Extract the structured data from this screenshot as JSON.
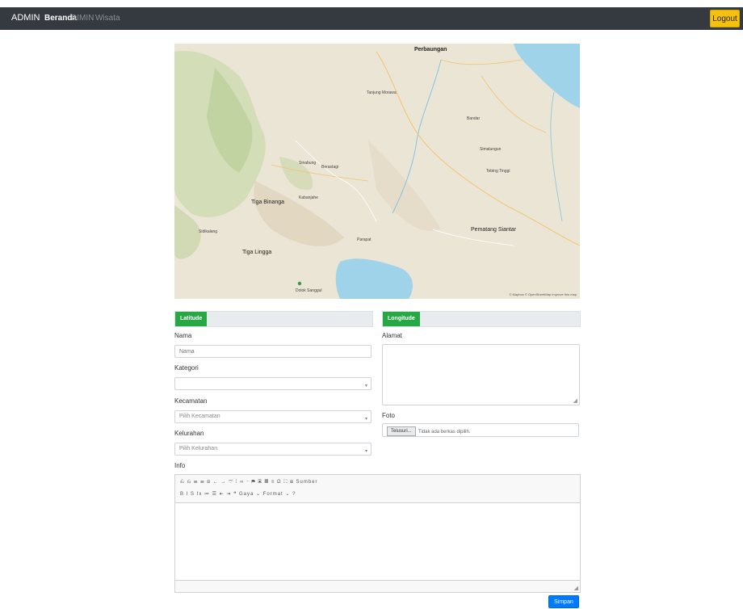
{
  "navbar": {
    "brand": "ADMIN",
    "links": [
      "Beranda",
      "DIMIN",
      "Wisata"
    ],
    "logout_label": "Logout"
  },
  "map": {
    "places": {
      "perbaungan": "Perbaungan",
      "pematang_siantar": "Pematang Siantar",
      "tiga_binanga": "Tiga Binanga",
      "tiga_lingga": "Tiga Lingga",
      "sinabung": "Sinabung",
      "tanjung_morawa": "Tanjung Morawa",
      "kabanjahe": "Kabanjahe",
      "sidikalang": "Sidikalang",
      "tebing_tinggi": "Tebing Tinggi",
      "simalungun": "Simalungun",
      "berastagi": "Berastagi",
      "parapat": "Parapat",
      "bandar": "Bandar",
      "dolok": "Dolok Sanggul"
    },
    "attribution": "© Mapbox © OpenStreetMap Improve this map"
  },
  "form": {
    "latitude_tab": "Latitude",
    "longitude_tab": "Longitude",
    "nama_label": "Nama",
    "nama_placeholder": "Nama",
    "kategori_label": "Kategori",
    "kategori_value": "",
    "kecamatan_label": "Kecamatan",
    "kecamatan_value": "Pilih Kecamatan",
    "kelurahan_label": "Kelurahan",
    "kelurahan_value": "Pilih Kelurahan",
    "alamat_label": "Alamat",
    "foto_label": "Foto",
    "file_button": "Telusuri...",
    "file_status": "Tidak ada berkas dipilih.",
    "info_label": "Info"
  },
  "editor": {
    "toolbar_row1": "⎌ ⎌ ☰ ☰ ⊟ ← → ▽ ⁞ ∞ ⌁ ⚑ ▣ ▦ ≡ Ω ⛶ ⊞ Sumber",
    "toolbar_row2": "B I S Ix ≔ ☰ ⇤ ⇥ ❝ Gaya ⌄ Format ⌄ ?"
  },
  "save_label": "Simpan"
}
